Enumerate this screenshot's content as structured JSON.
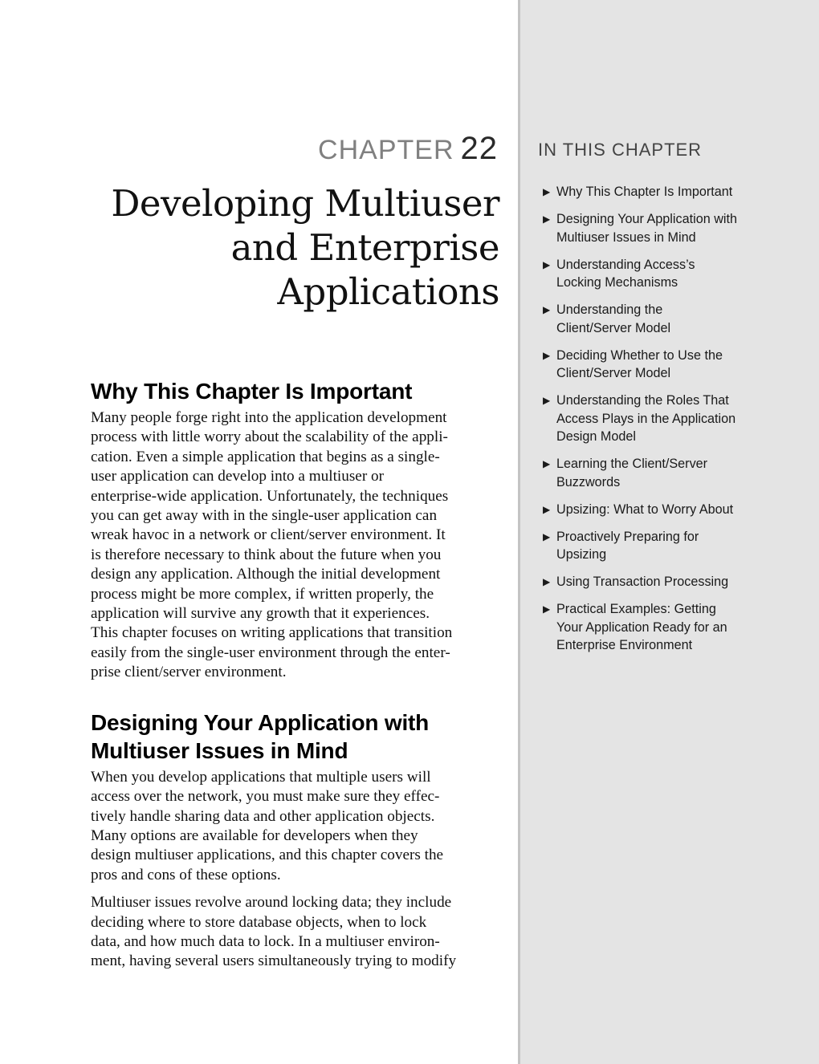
{
  "chapter": {
    "label": "CHAPTER",
    "number": "22",
    "title_lines": [
      "Developing Multiuser",
      "and Enterprise",
      "Applications"
    ]
  },
  "sidebar": {
    "heading": "IN THIS CHAPTER",
    "bullet_icon": "triangle-right-icon",
    "items": [
      {
        "lines": [
          "Why This Chapter Is Important"
        ]
      },
      {
        "lines": [
          "Designing Your Application with",
          "Multiuser Issues in Mind"
        ]
      },
      {
        "lines": [
          "Understanding Access’s",
          "Locking Mechanisms"
        ]
      },
      {
        "lines": [
          "Understanding the",
          "Client/Server Model"
        ]
      },
      {
        "lines": [
          "Deciding Whether to Use the",
          "Client/Server Model"
        ]
      },
      {
        "lines": [
          "Understanding the Roles That",
          "Access Plays in the Application",
          "Design Model"
        ]
      },
      {
        "lines": [
          "Learning the Client/Server",
          "Buzzwords"
        ]
      },
      {
        "lines": [
          "Upsizing: What to Worry About"
        ]
      },
      {
        "lines": [
          "Proactively Preparing for",
          "Upsizing"
        ]
      },
      {
        "lines": [
          "Using Transaction Processing"
        ]
      },
      {
        "lines": [
          "Practical Examples: Getting",
          "Your Application Ready for an",
          "Enterprise Environment"
        ]
      }
    ]
  },
  "sections": [
    {
      "heading_lines": [
        "Why This Chapter Is Important"
      ],
      "paragraphs": [
        [
          "Many people forge right into the application development",
          "process with little worry about the scalability of the appli-",
          "cation. Even a simple application that begins as a single-",
          "user application can develop into a multiuser or",
          "enterprise-wide application. Unfortunately, the techniques",
          "you can get away with in the single-user application can",
          "wreak havoc in a network or client/server environment. It",
          "is therefore necessary to think about the future when you",
          "design any application. Although the initial development",
          "process might be more complex, if written properly, the",
          "application will survive any growth that it experiences.",
          "This chapter focuses on writing applications that transition",
          "easily from the single-user environment through the enter-",
          "prise client/server environment."
        ]
      ]
    },
    {
      "heading_lines": [
        "Designing Your Application with",
        "Multiuser Issues in Mind"
      ],
      "paragraphs": [
        [
          "When you develop applications that multiple users will",
          "access over the network, you must make sure they effec-",
          "tively handle sharing data and other application objects.",
          "Many options are available for developers when they",
          "design multiuser applications, and this chapter covers the",
          "pros and cons of these options."
        ],
        [
          "Multiuser issues revolve around locking data; they include",
          "deciding where to store database objects, when to lock",
          "data, and how much data to lock. In a multiuser environ-",
          "ment, having several users simultaneously trying to modify"
        ]
      ]
    }
  ]
}
